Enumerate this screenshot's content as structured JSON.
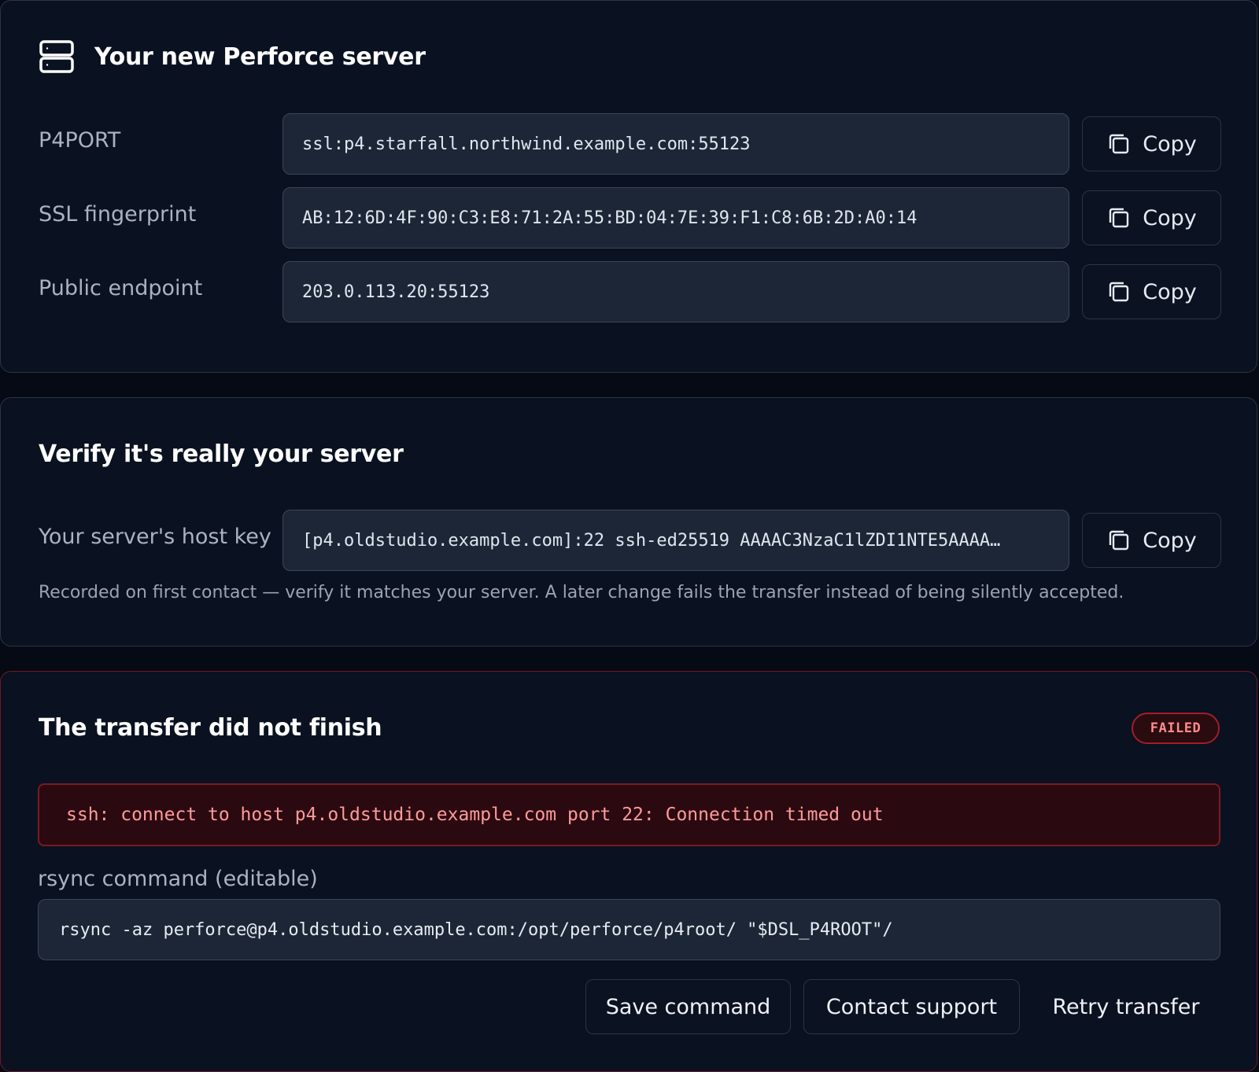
{
  "server_card": {
    "title": "Your new Perforce server",
    "icon": "server-icon",
    "fields": [
      {
        "label": "P4PORT",
        "value": "ssl:p4.starfall.northwind.example.com:55123",
        "copy_label": "Copy"
      },
      {
        "label": "SSL fingerprint",
        "value": "AB:12:6D:4F:90:C3:E8:71:2A:55:BD:04:7E:39:F1:C8:6B:2D:A0:14",
        "copy_label": "Copy"
      },
      {
        "label": "Public endpoint",
        "value": "203.0.113.20:55123",
        "copy_label": "Copy"
      }
    ]
  },
  "verify_card": {
    "title": "Verify it's really your server",
    "host_key_label": "Your server's host key",
    "host_key_value": "[p4.oldstudio.example.com]:22 ssh-ed25519 AAAAC3NzaC1lZDI1NTE5AAAA…",
    "copy_label": "Copy",
    "note": "Recorded on first contact — verify it matches your server. A later change fails the transfer instead of being silently accepted."
  },
  "failure_card": {
    "title": "The transfer did not finish",
    "status_badge": "FAILED",
    "error_message": "ssh: connect to host p4.oldstudio.example.com port 22: Connection timed out",
    "command_label": "rsync command (editable)",
    "command_value": "rsync -az perforce@p4.oldstudio.example.com:/opt/perforce/p4root/ \"$DSL_P4ROOT\"/",
    "actions": {
      "save": "Save command",
      "contact": "Contact support",
      "retry": "Retry transfer"
    }
  },
  "colors": {
    "background": "#050a14",
    "card": "#0a1120",
    "field": "#1c2636",
    "error_text": "#ff9a9a",
    "error_border": "#7a1a22",
    "badge_text": "#ff8b8b"
  }
}
